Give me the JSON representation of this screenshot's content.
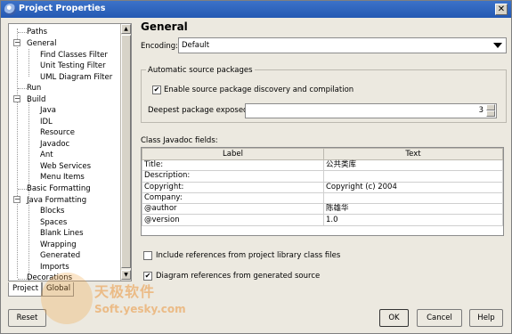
{
  "window": {
    "title": "Project Properties",
    "close_label": "✕"
  },
  "tree": {
    "items": [
      {
        "label": "Paths"
      },
      {
        "label": "General",
        "expander": "−"
      },
      {
        "label": "Find Classes Filter"
      },
      {
        "label": "Unit Testing Filter"
      },
      {
        "label": "UML Diagram Filter"
      },
      {
        "label": "Run"
      },
      {
        "label": "Build",
        "expander": "−"
      },
      {
        "label": "Java"
      },
      {
        "label": "IDL"
      },
      {
        "label": "Resource"
      },
      {
        "label": "Javadoc"
      },
      {
        "label": "Ant"
      },
      {
        "label": "Web Services"
      },
      {
        "label": "Menu Items"
      },
      {
        "label": "Basic Formatting"
      },
      {
        "label": "Java Formatting",
        "expander": "−"
      },
      {
        "label": "Blocks"
      },
      {
        "label": "Spaces"
      },
      {
        "label": "Blank Lines"
      },
      {
        "label": "Wrapping"
      },
      {
        "label": "Generated"
      },
      {
        "label": "Imports"
      },
      {
        "label": "Decorations"
      }
    ]
  },
  "tabs": [
    {
      "label": "Project"
    },
    {
      "label": "Global"
    }
  ],
  "general": {
    "heading": "General",
    "encoding_label": "Encoding:",
    "encoding_value": "Default",
    "auto_group_title": "Automatic source packages",
    "enable_discovery_label": "Enable source package discovery and compilation",
    "enable_discovery_checked": "✔",
    "deepest_label": "Deepest package exposed:",
    "deepest_value": "3",
    "javadoc_label": "Class Javadoc fields:",
    "javadoc_headers": {
      "label": "Label",
      "text": "Text"
    },
    "javadoc_rows": [
      {
        "label": "Title:",
        "text": "公共类库"
      },
      {
        "label": "Description:",
        "text": ""
      },
      {
        "label": "Copyright:",
        "text": "Copyright (c) 2004"
      },
      {
        "label": "Company:",
        "text": ""
      },
      {
        "label": "@author",
        "text": "陈雄华"
      },
      {
        "label": "@version",
        "text": "1.0"
      }
    ],
    "include_refs_label": "Include references from project library class files",
    "diagram_refs_label": "Diagram references from generated source",
    "diagram_refs_checked": "✔"
  },
  "buttons": {
    "reset": "Reset",
    "ok": "OK",
    "cancel": "Cancel",
    "help": "Help"
  },
  "watermark": {
    "line1": "天极软件",
    "line2": "Soft.yesky.com"
  }
}
